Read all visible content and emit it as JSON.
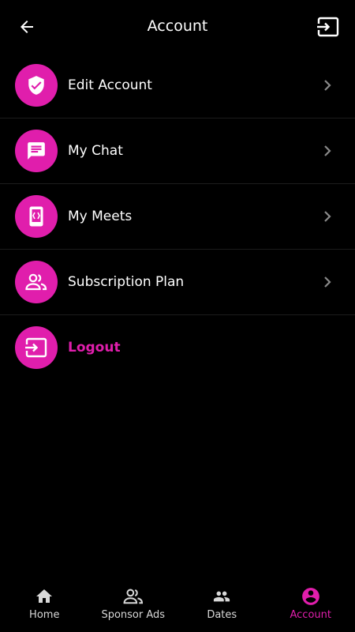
{
  "header": {
    "title": "Account",
    "back_icon": "arrow-left-icon",
    "exit_icon": "exit-to-app-icon"
  },
  "menu": {
    "items": [
      {
        "label": "Edit Account",
        "icon": "shield-check-icon"
      },
      {
        "label": "My Chat",
        "icon": "chat-icon"
      },
      {
        "label": "My Meets",
        "icon": "phone-meet-icon"
      },
      {
        "label": "Subscription Plan",
        "icon": "people-icon"
      },
      {
        "label": "Logout",
        "icon": "logout-icon"
      }
    ]
  },
  "tabs": [
    {
      "label": "Home",
      "icon": "home-icon"
    },
    {
      "label": "Sponsor Ads",
      "icon": "people-outline-icon"
    },
    {
      "label": "Dates",
      "icon": "people-icon"
    },
    {
      "label": "Account",
      "icon": "account-circle-icon",
      "active": true
    }
  ],
  "colors": {
    "accent": "#e01eac",
    "background": "#000000",
    "divider": "#1c1c1c"
  }
}
